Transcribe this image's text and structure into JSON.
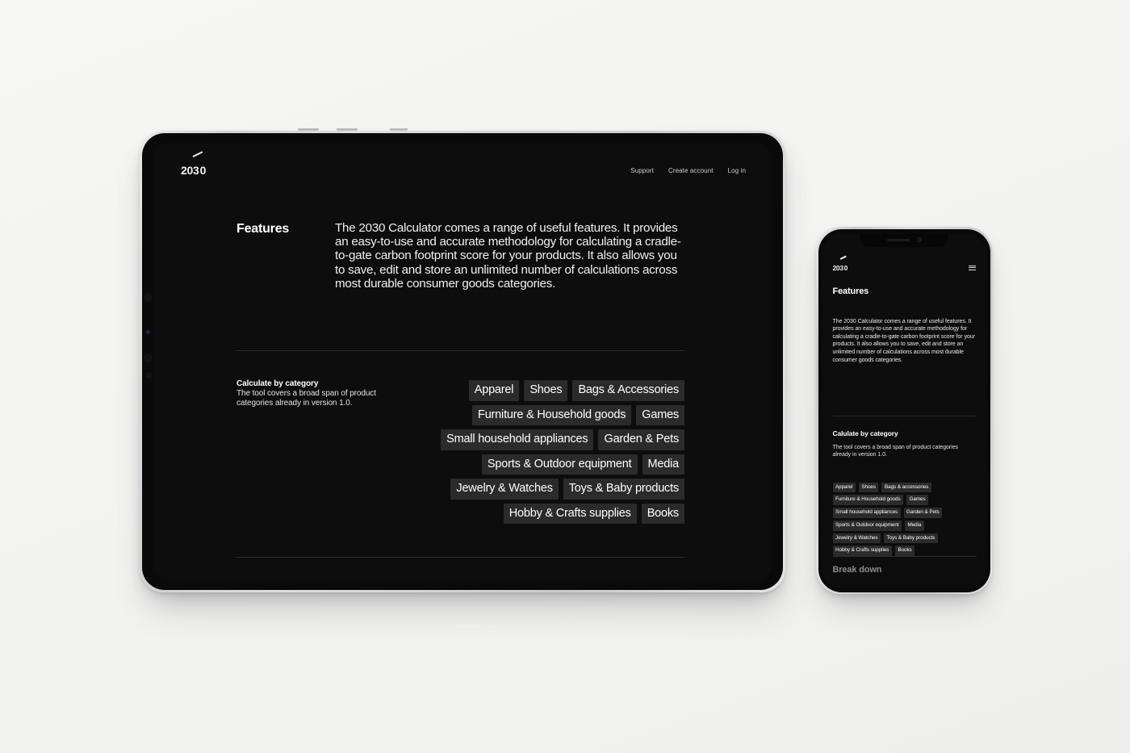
{
  "scene": {
    "background_color": "#f4f4f2",
    "devices": [
      "tablet",
      "phone"
    ]
  },
  "brand": {
    "logo_prefix": "20",
    "logo_mid": "3",
    "logo_suffix": "0",
    "logo_full": "2030"
  },
  "tablet": {
    "nav": [
      {
        "label": "Support"
      },
      {
        "label": "Create account"
      },
      {
        "label": "Log in"
      }
    ],
    "section_features": {
      "title": "Features",
      "body": "The 2030 Calculator comes a range of useful features. It provides an easy-to-use and accurate methodology for calculating a cradle-to-gate carbon footprint score for your products. It also allows you to save, edit and store an unlimited number of calculations across most durable consumer goods categories."
    },
    "section_categories": {
      "heading": "Calculate by category",
      "subtext": "The tool covers a broad span of product categories already in version 1.0.",
      "tag_rows": [
        [
          "Apparel",
          "Shoes",
          "Bags & Accessories"
        ],
        [
          "Furniture & Household goods",
          "Games"
        ],
        [
          "Small household appliances",
          "Garden & Pets"
        ],
        [
          "Sports & Outdoor equipment",
          "Media"
        ],
        [
          "Jewelry & Watches",
          "Toys & Baby products"
        ],
        [
          "Hobby & Crafts supplies",
          "Books"
        ]
      ]
    }
  },
  "phone": {
    "menu_icon": "hamburger-menu-icon",
    "section_features": {
      "title": "Features",
      "body": "The 2030 Calculator comes a range of useful features. It provides an easy-to-use and accurate methodology for calculating a cradle-to-gate carbon footprint score for your products. It also allows you to save, edit and store an unlimited number of calculations across most durable consumer goods categories."
    },
    "section_categories": {
      "heading": "Calulate by category",
      "subtext": "The tool covers a broad span of product categories already in version 1.0.",
      "tag_rows": [
        [
          "Apparel",
          "Shoes",
          "Bags & accessories"
        ],
        [
          "Furniture & Household goods",
          "Games"
        ],
        [
          "Small household appliances",
          "Garden & Pets"
        ],
        [
          "Sports & Outdoor equipment",
          "Media"
        ],
        [
          "Jewelry & Watches",
          "Toys & Baby products"
        ],
        [
          "Hobby & Crafts supplies",
          "Books"
        ]
      ]
    },
    "next_section_heading": "Break down"
  },
  "colors": {
    "screen_bg": "#0d0d0d",
    "bezel": "#0a0a0a",
    "tag_bg": "#2b2b2b",
    "text_primary": "#ffffff",
    "text_muted": "#cfcfcf",
    "divider": "#2e2e2e"
  }
}
